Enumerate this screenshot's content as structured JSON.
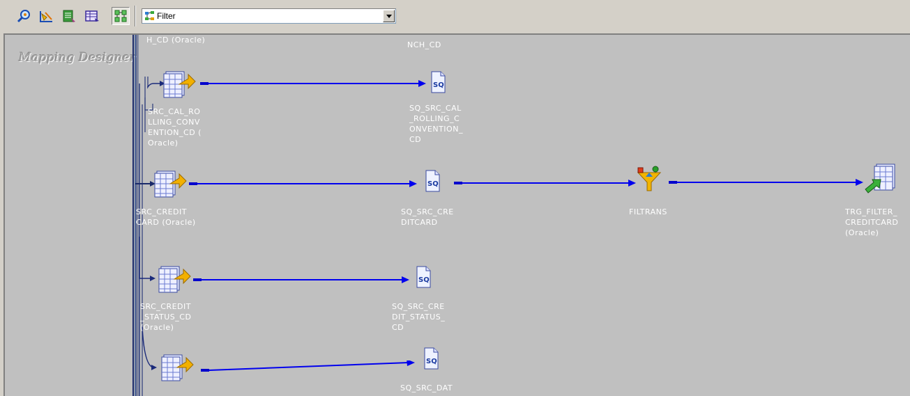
{
  "toolbar": {
    "buttons": [
      {
        "name": "zoom-transformation-icon"
      },
      {
        "name": "arrange-icon"
      },
      {
        "name": "edit-transformation-icon"
      },
      {
        "name": "table-view-icon"
      },
      {
        "name": "iconize-icon",
        "pressed": true
      }
    ],
    "combo": {
      "icon": "filter-transformation-icon",
      "value": "Filter"
    }
  },
  "overview": {
    "title": "Mapping Designer"
  },
  "nodes": {
    "top_partial_src": "H_CD (Oracle)",
    "top_partial_sq": "NCH_CD",
    "src_cal_rolling": [
      "SRC_CAL_RO",
      "LLING_CONV",
      "ENTION_CD (",
      "Oracle)"
    ],
    "sq_cal_rolling": [
      "SQ_SRC_CAL",
      "_ROLLING_C",
      "ONVENTION_",
      "CD"
    ],
    "src_creditcard": [
      "SRC_CREDIT",
      "CARD (Oracle)"
    ],
    "sq_creditcard": [
      "SQ_SRC_CRE",
      "DITCARD"
    ],
    "filtrans": [
      "FILTRANS"
    ],
    "trg_filter": [
      "TRG_FILTER_",
      "CREDITCARD",
      "(Oracle)"
    ],
    "src_credit_status": [
      "SRC_CREDIT",
      "_STATUS_CD",
      "(Oracle)"
    ],
    "sq_credit_status": [
      "SQ_SRC_CRE",
      "DIT_STATUS_",
      "CD"
    ],
    "sq_dat": [
      "SQ_SRC_DAT"
    ]
  },
  "colors": {
    "link": "#0000ee",
    "canvas": "#c0c0c0",
    "label": "#ffffff"
  }
}
